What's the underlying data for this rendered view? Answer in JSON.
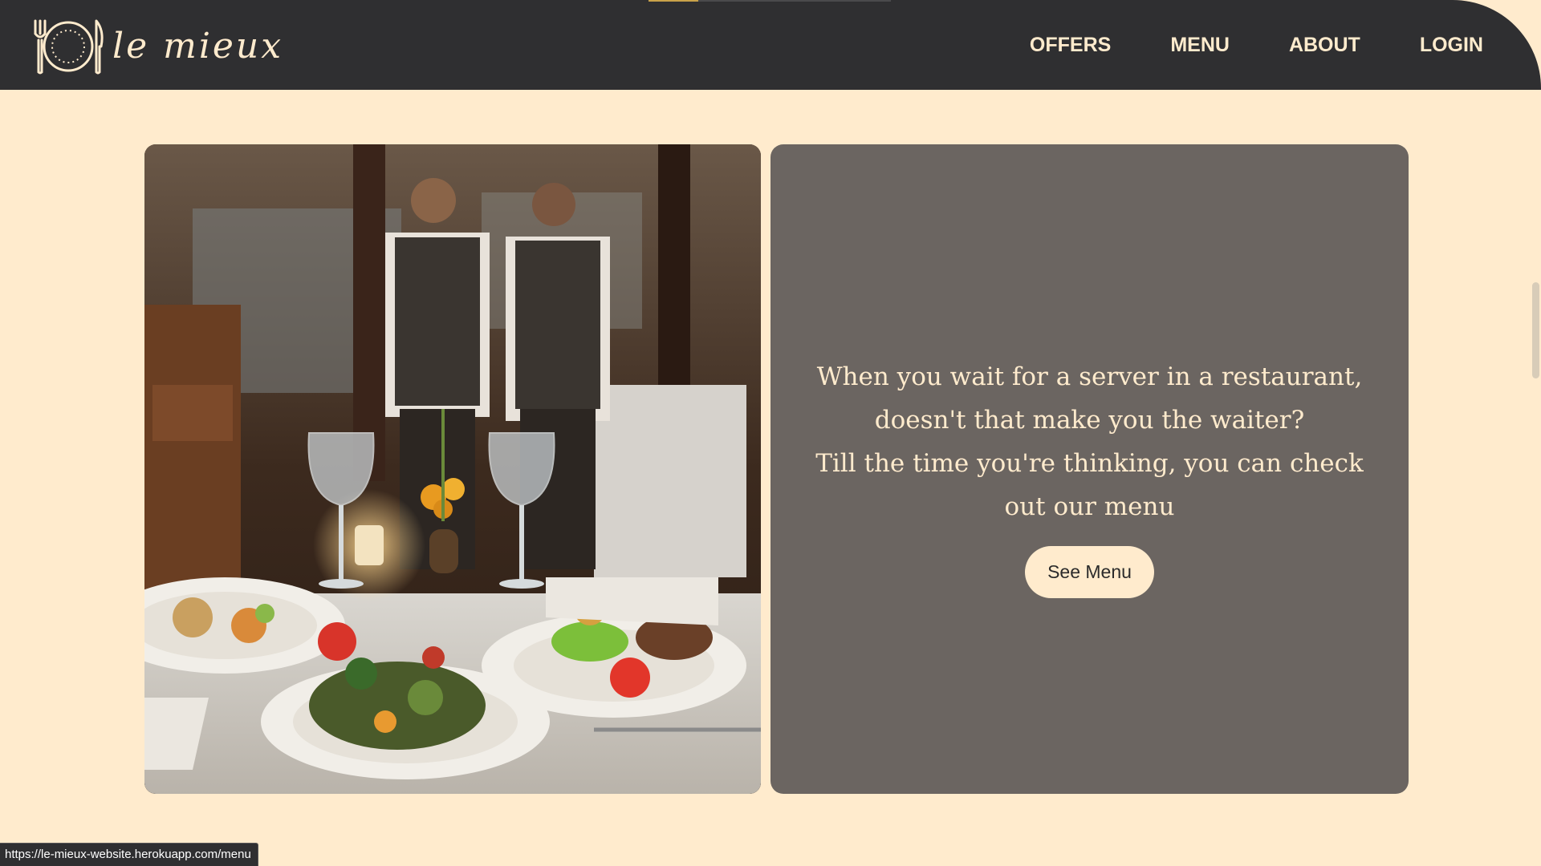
{
  "brand": {
    "name": "le mieux"
  },
  "nav": {
    "items": [
      {
        "label": "OFFERS"
      },
      {
        "label": "MENU"
      },
      {
        "label": "ABOUT"
      },
      {
        "label": "LOGIN"
      }
    ]
  },
  "hero": {
    "quote_line1": "When you wait for a server in a restaurant, doesn't that make you the waiter?",
    "quote_line2": "Till the time you're thinking, you can check out our menu",
    "button_label": "See Menu"
  },
  "status_bar": {
    "url": "https://le-mieux-website.herokuapp.com/menu"
  },
  "colors": {
    "nav_background": "#2f2f31",
    "page_background": "#ffebcd",
    "card_background": "#6b6561",
    "accent_text": "#ffebcd"
  }
}
